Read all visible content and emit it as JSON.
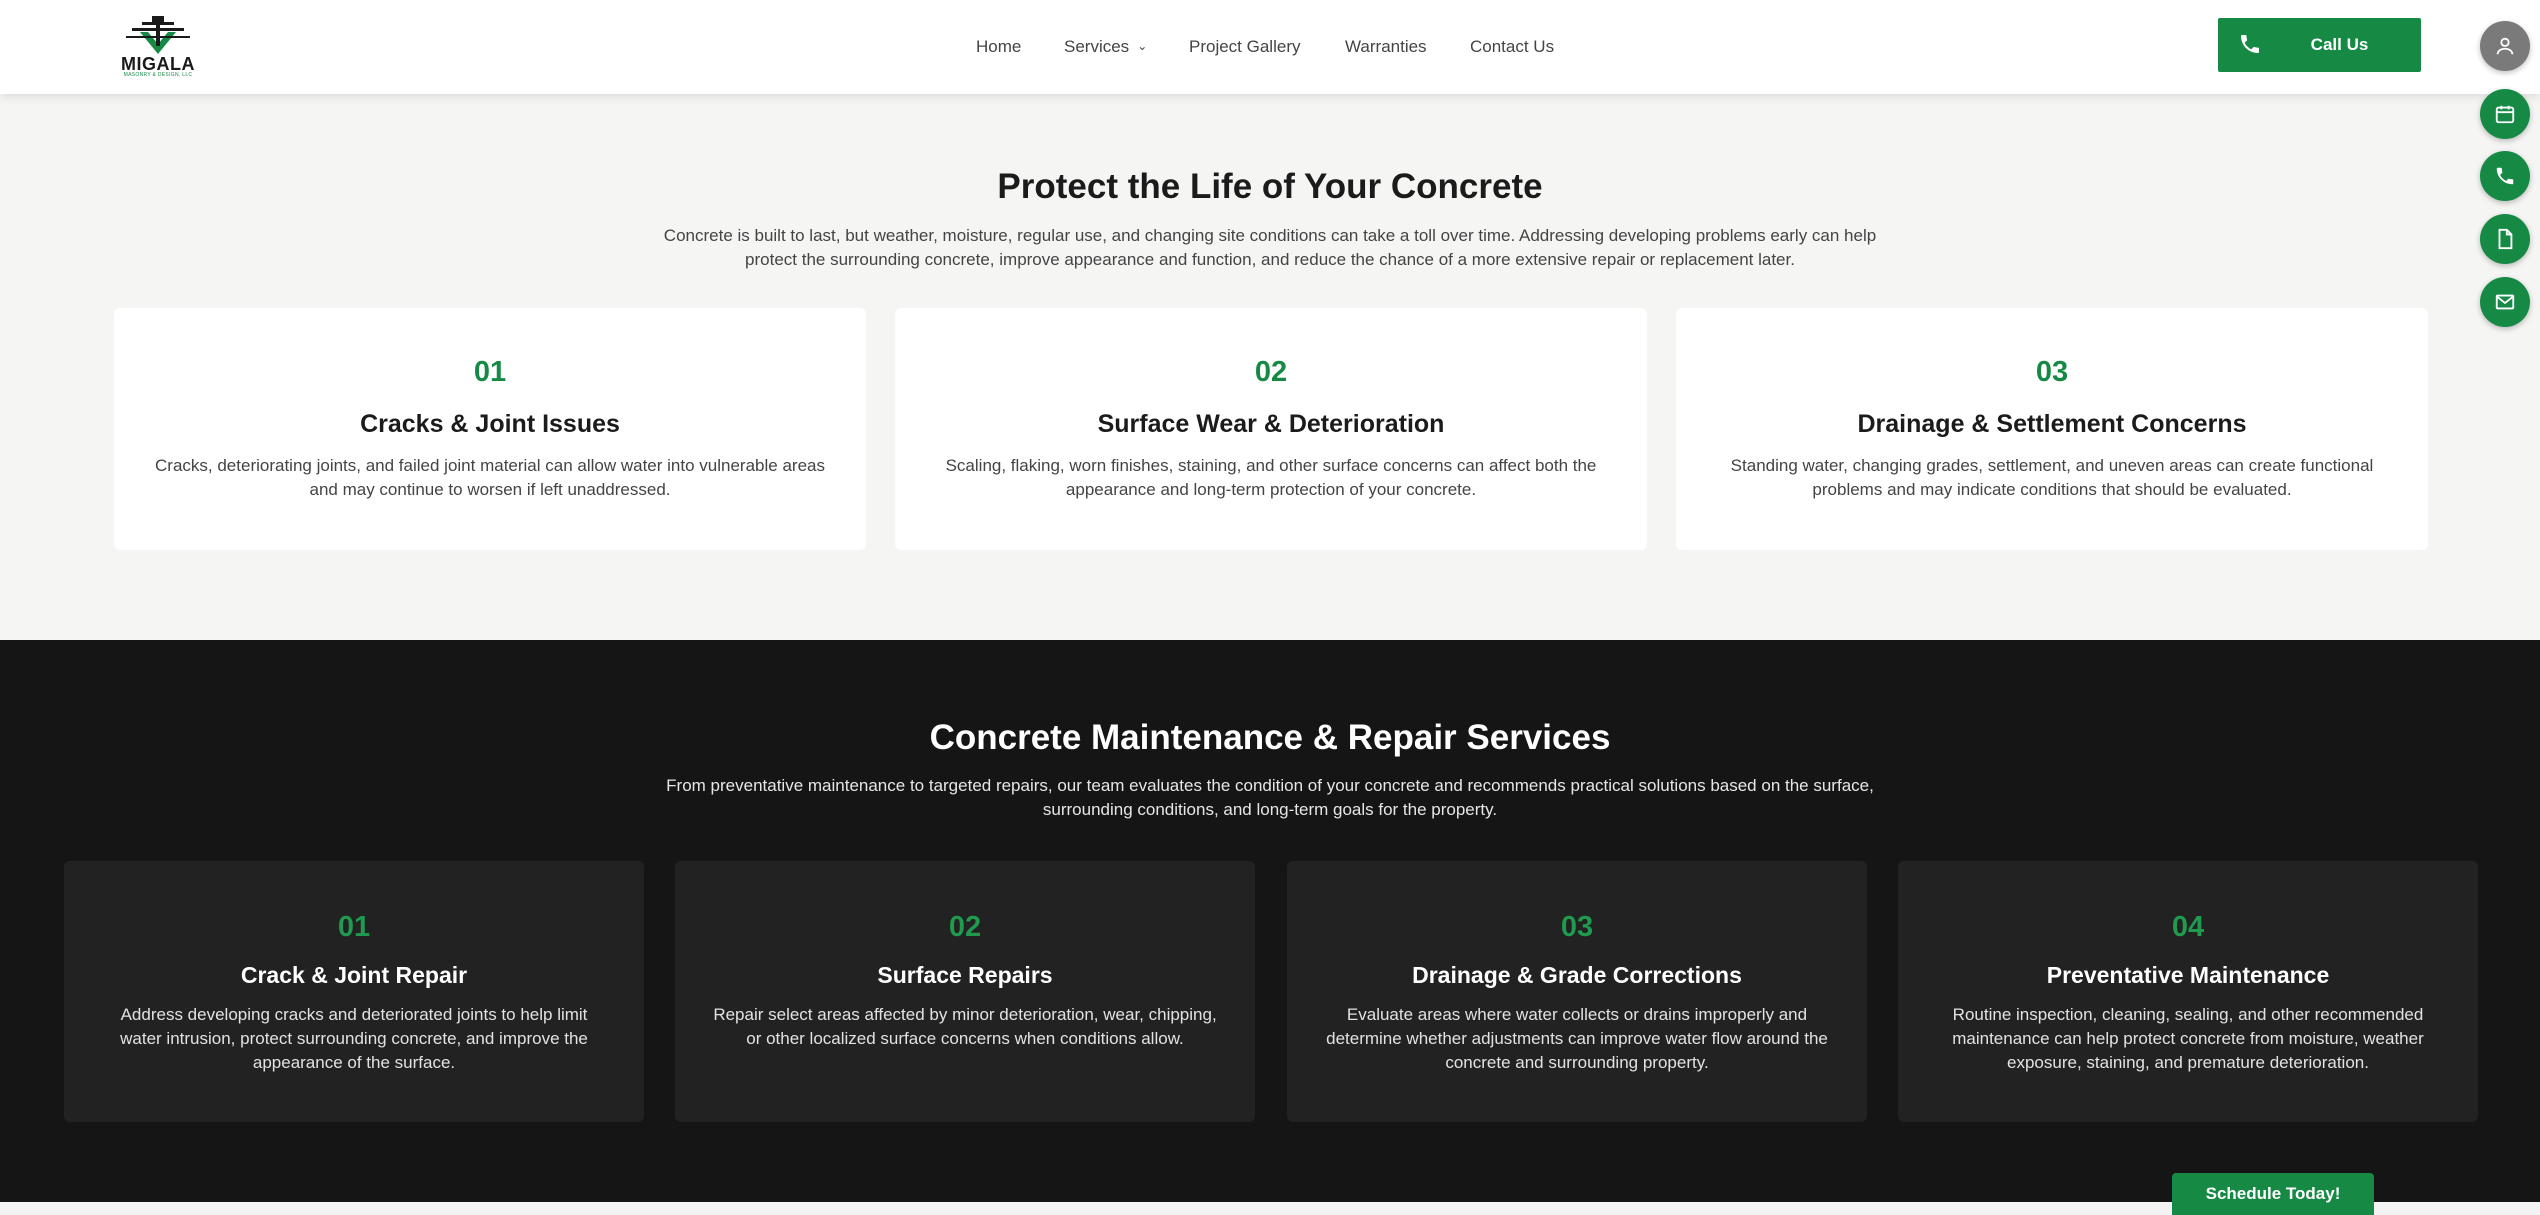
{
  "header": {
    "logo_text": "MIGALA",
    "logo_subtext": "MASONRY & DESIGN, LLC",
    "nav": [
      {
        "label": "Home"
      },
      {
        "label": "Services"
      },
      {
        "label": "Project Gallery"
      },
      {
        "label": "Warranties"
      },
      {
        "label": "Contact Us"
      }
    ],
    "call_label": "Call Us"
  },
  "side_buttons": [
    "user-icon",
    "calendar-icon",
    "phone-icon",
    "document-icon",
    "mail-icon"
  ],
  "protect": {
    "title": "Protect the Life of Your Concrete",
    "description": "Concrete is built to last, but weather, moisture, regular use, and changing site conditions can take a toll over time. Addressing developing problems early can help protect the surrounding concrete, improve appearance and function, and reduce the chance of a more extensive repair or replacement later.",
    "cards": [
      {
        "num": "01",
        "title": "Cracks & Joint Issues",
        "text": "Cracks, deteriorating joints, and failed joint material can allow water into vulnerable areas and may continue to worsen if left unaddressed."
      },
      {
        "num": "02",
        "title": "Surface Wear & Deterioration",
        "text": "Scaling, flaking, worn finishes, staining, and other surface concerns can affect both the appearance and long-term protection of your concrete."
      },
      {
        "num": "03",
        "title": "Drainage & Settlement Concerns",
        "text": "Standing water, changing grades, settlement, and uneven areas can create functional problems and may indicate conditions that should be evaluated."
      }
    ]
  },
  "services": {
    "title": "Concrete Maintenance & Repair Services",
    "description": "From preventative maintenance to targeted repairs, our team evaluates the condition of your concrete and recommends practical solutions based on the surface, surrounding conditions, and long-term goals for the property.",
    "cards": [
      {
        "num": "01",
        "title": "Crack & Joint Repair",
        "text": "Address developing cracks and deteriorated joints to help limit water intrusion, protect surrounding concrete, and improve the appearance of the surface."
      },
      {
        "num": "02",
        "title": "Surface Repairs",
        "text": "Repair select areas affected by minor deterioration, wear, chipping, or other localized surface concerns when conditions allow."
      },
      {
        "num": "03",
        "title": "Drainage & Grade Corrections",
        "text": "Evaluate areas where water collects or drains improperly and determine whether adjustments can improve water flow around the concrete and surrounding property."
      },
      {
        "num": "04",
        "title": "Preventative Maintenance",
        "text": "Routine inspection, cleaning, sealing, and other recommended maintenance can help protect concrete from moisture, weather exposure, staining, and premature deterioration."
      }
    ]
  },
  "schedule_label": "Schedule Today!",
  "colors": {
    "accent": "#168a45",
    "dark_bg": "#151515",
    "dark_card": "#222222",
    "light_bg": "#f5f5f4"
  }
}
